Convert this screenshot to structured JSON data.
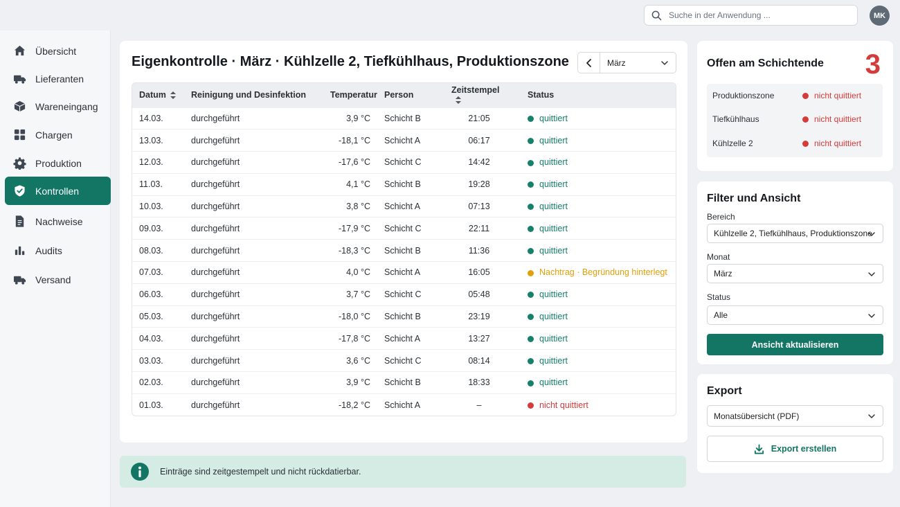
{
  "header": {
    "search_placeholder": "Suche in der Anwendung ...",
    "avatar_initials": "MK"
  },
  "sidebar": {
    "items": [
      {
        "label": "Übersicht",
        "icon": "home-icon",
        "active": false
      },
      {
        "label": "Lieferanten",
        "icon": "truck-icon",
        "active": false
      },
      {
        "label": "Wareneingang",
        "icon": "box-icon",
        "active": false
      },
      {
        "label": "Chargen",
        "icon": "grid-icon",
        "active": false
      },
      {
        "label": "Produktion",
        "icon": "gear-icon",
        "active": false
      },
      {
        "label": "Kontrollen",
        "icon": "shield-check-icon",
        "active": true
      },
      {
        "label": "Nachweise",
        "icon": "document-icon",
        "active": false
      },
      {
        "label": "Audits",
        "icon": "bar-chart-icon",
        "active": false
      },
      {
        "label": "Versand",
        "icon": "truck-icon",
        "active": false
      }
    ]
  },
  "main": {
    "title": "Eigenkontrolle · März · Kühlzelle 2, Tiefkühlhaus, Produktionszone",
    "month_select": "März",
    "columns": [
      "Datum",
      "Reinigung und Desinfektion",
      "Temperatur",
      "Person",
      "Zeitstempel",
      "Status"
    ],
    "rows": [
      {
        "datum": "14.03.",
        "reinigung": "durchgeführt",
        "temperatur": "3,9 °C",
        "person": "Schicht B",
        "zeit": "21:05",
        "status": "quittiert",
        "state": "ok"
      },
      {
        "datum": "13.03.",
        "reinigung": "durchgeführt",
        "temperatur": "-18,1 °C",
        "person": "Schicht A",
        "zeit": "06:17",
        "status": "quittiert",
        "state": "ok"
      },
      {
        "datum": "12.03.",
        "reinigung": "durchgeführt",
        "temperatur": "-17,6 °C",
        "person": "Schicht C",
        "zeit": "14:42",
        "status": "quittiert",
        "state": "ok"
      },
      {
        "datum": "11.03.",
        "reinigung": "durchgeführt",
        "temperatur": "4,1 °C",
        "person": "Schicht B",
        "zeit": "19:28",
        "status": "quittiert",
        "state": "ok"
      },
      {
        "datum": "10.03.",
        "reinigung": "durchgeführt",
        "temperatur": "3,8 °C",
        "person": "Schicht A",
        "zeit": "07:13",
        "status": "quittiert",
        "state": "ok"
      },
      {
        "datum": "09.03.",
        "reinigung": "durchgeführt",
        "temperatur": "-17,9 °C",
        "person": "Schicht C",
        "zeit": "22:11",
        "status": "quittiert",
        "state": "ok"
      },
      {
        "datum": "08.03.",
        "reinigung": "durchgeführt",
        "temperatur": "-18,3 °C",
        "person": "Schicht B",
        "zeit": "11:36",
        "status": "quittiert",
        "state": "ok"
      },
      {
        "datum": "07.03.",
        "reinigung": "durchgeführt",
        "temperatur": "4,0 °C",
        "person": "Schicht A",
        "zeit": "16:05",
        "status": "Nachtrag · Begründung hinterlegt",
        "state": "warn"
      },
      {
        "datum": "06.03.",
        "reinigung": "durchgeführt",
        "temperatur": "3,7 °C",
        "person": "Schicht C",
        "zeit": "05:48",
        "status": "quittiert",
        "state": "ok"
      },
      {
        "datum": "05.03.",
        "reinigung": "durchgeführt",
        "temperatur": "-18,0 °C",
        "person": "Schicht B",
        "zeit": "23:19",
        "status": "quittiert",
        "state": "ok"
      },
      {
        "datum": "04.03.",
        "reinigung": "durchgeführt",
        "temperatur": "-17,8 °C",
        "person": "Schicht A",
        "zeit": "13:27",
        "status": "quittiert",
        "state": "ok"
      },
      {
        "datum": "03.03.",
        "reinigung": "durchgeführt",
        "temperatur": "3,6 °C",
        "person": "Schicht C",
        "zeit": "08:14",
        "status": "quittiert",
        "state": "ok"
      },
      {
        "datum": "02.03.",
        "reinigung": "durchgeführt",
        "temperatur": "3,9 °C",
        "person": "Schicht B",
        "zeit": "18:33",
        "status": "quittiert",
        "state": "ok"
      },
      {
        "datum": "01.03.",
        "reinigung": "durchgeführt",
        "temperatur": "-18,2 °C",
        "person": "Schicht A",
        "zeit": "–",
        "status": "nicht quittiert",
        "state": "bad"
      }
    ],
    "info_text": "Einträge sind zeitgestempelt und nicht rückdatierbar."
  },
  "offen": {
    "title": "Offen am Schichtende",
    "count": "3",
    "items": [
      {
        "name": "Produktionszone",
        "state": "nicht quittiert"
      },
      {
        "name": "Tiefkühlhaus",
        "state": "nicht quittiert"
      },
      {
        "name": "Kühlzelle 2",
        "state": "nicht quittiert"
      }
    ]
  },
  "filter": {
    "title": "Filter und Ansicht",
    "bereich_label": "Bereich",
    "bereich_value": "Kühlzelle 2, Tiefkühlhaus, Produktionszone",
    "monat_label": "Monat",
    "monat_value": "März",
    "status_label": "Status",
    "status_value": "Alle",
    "apply_label": "Ansicht aktualisieren"
  },
  "export": {
    "title": "Export",
    "format_value": "Monatsübersicht (PDF)",
    "button_label": "Export erstellen"
  },
  "colors": {
    "accent": "#137563",
    "ok": "#15806b",
    "warn": "#e1a00b",
    "bad": "#d43b3b"
  }
}
